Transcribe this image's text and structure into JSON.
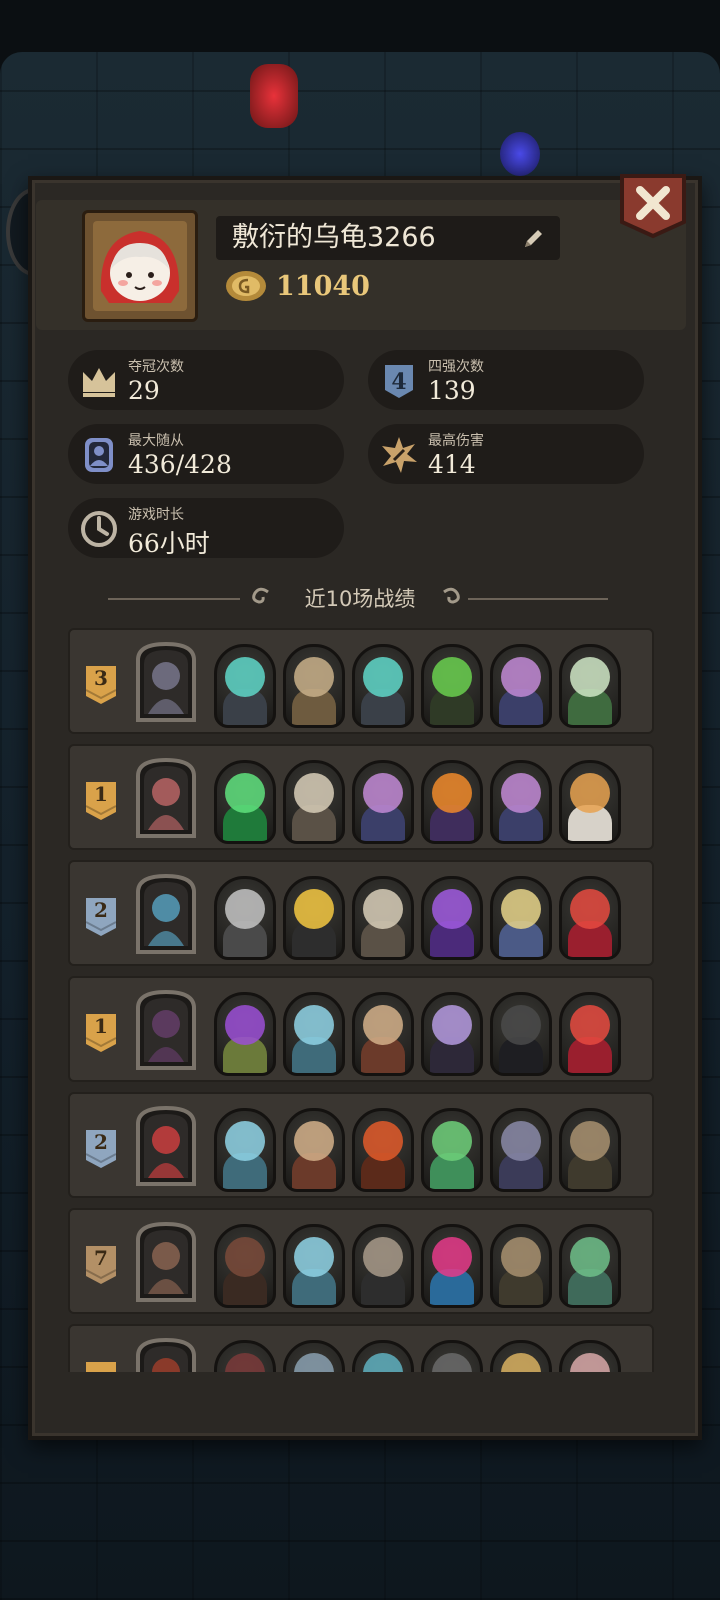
{
  "profile": {
    "name": "敷衍的乌龟3266",
    "coins": "11040",
    "avatar": "red-hood-girl-avatar"
  },
  "stats": [
    {
      "id": "crowns",
      "label": "夺冠次数",
      "value": "29",
      "icon": "crown-icon"
    },
    {
      "id": "top4",
      "label": "四强次数",
      "value": "139",
      "icon": "rank-4-shield-icon"
    },
    {
      "id": "max-followers",
      "label": "最大随从",
      "value": "436/428",
      "icon": "minion-card-icon"
    },
    {
      "id": "max-damage",
      "label": "最高伤害",
      "value": "414",
      "icon": "damage-burst-icon"
    },
    {
      "id": "playtime",
      "label": "游戏时长",
      "value": "66小时",
      "icon": "clock-icon"
    }
  ],
  "records_title": "近10场战绩",
  "colors": {
    "panel": "#2b2824",
    "rank_gold": "#d9a24a",
    "rank_silver": "#8fa6bf",
    "rank_bronze": "#b39066",
    "coin": "#e9c77a"
  },
  "records": [
    {
      "rank": "3",
      "tier": "gold",
      "hero": "wizard-hero",
      "hero_color": "#6c6a7c",
      "units": [
        [
          "#5fd7c9",
          "#3a4048"
        ],
        [
          "#c9b08a",
          "#6e5b3f"
        ],
        [
          "#5fd7c9",
          "#3a4048"
        ],
        [
          "#6ad04f",
          "#2f3a26"
        ],
        [
          "#c28ad6",
          "#3b3f69"
        ],
        [
          "#cfe6c6",
          "#3f6b3f"
        ]
      ]
    },
    {
      "rank": "1",
      "tier": "gold",
      "hero": "rat-hero",
      "hero_color": "#a35b5b",
      "units": [
        [
          "#5fe27e",
          "#1f7a3a"
        ],
        [
          "#d8ceb8",
          "#5a5146"
        ],
        [
          "#c28ad6",
          "#3b3f69"
        ],
        [
          "#f08a2a",
          "#3f2d5c"
        ],
        [
          "#c28ad6",
          "#3b3f69"
        ],
        [
          "#e8a250",
          "#d7d2c9"
        ]
      ]
    },
    {
      "rank": "2",
      "tier": "silver",
      "hero": "witch-hero",
      "hero_color": "#4f8ca5",
      "units": [
        [
          "#c4c4c4",
          "#4a4a4a"
        ],
        [
          "#f5c842",
          "#2d2d2d"
        ],
        [
          "#d8ceb8",
          "#5a5146"
        ],
        [
          "#a05ae0",
          "#4b2a7a"
        ],
        [
          "#e6d38a",
          "#4b5a86"
        ],
        [
          "#e64a3f",
          "#9a1f2e"
        ]
      ]
    },
    {
      "rank": "1",
      "tier": "gold",
      "hero": "cat-hero",
      "hero_color": "#5b3a5e",
      "units": [
        [
          "#9b4fd6",
          "#6b7a3a"
        ],
        [
          "#8fd3e6",
          "#3f6b7a"
        ],
        [
          "#d4b08a",
          "#6b3a2a"
        ],
        [
          "#b59ae0",
          "#2d2838"
        ],
        [
          "#4a4a4a",
          "#1e1e22"
        ],
        [
          "#e64a3f",
          "#9a1f2e"
        ]
      ]
    },
    {
      "rank": "2",
      "tier": "silver",
      "hero": "red-hood-hero",
      "hero_color": "#b23b3b",
      "units": [
        [
          "#8fd3e6",
          "#3f6b7a"
        ],
        [
          "#d4b08a",
          "#6b3a2a"
        ],
        [
          "#e25a2a",
          "#5b2a1a"
        ],
        [
          "#6fd07a",
          "#3f8f5a"
        ],
        [
          "#8a8aa8",
          "#3b3b58"
        ],
        [
          "#a89070",
          "#3f3a2d"
        ]
      ]
    },
    {
      "rank": "7",
      "tier": "bronze",
      "hero": "cat-king-hero",
      "hero_color": "#7a5a4a",
      "units": [
        [
          "#7a4a3a",
          "#3a2a22"
        ],
        [
          "#8fd3e6",
          "#3f6b7a"
        ],
        [
          "#a89a8a",
          "#2d2d2d"
        ],
        [
          "#e63a8a",
          "#2a6a9a"
        ],
        [
          "#a89070",
          "#3f3a2d"
        ],
        [
          "#6fc08a",
          "#3f6a5a"
        ]
      ]
    },
    {
      "rank": "",
      "tier": "gold",
      "hero": "fire-hero",
      "hero_color": "#8a3a2a",
      "units": [
        [
          "#7a3a3a",
          "#2d2222"
        ],
        [
          "#8aa0b0",
          "#3a3a3a"
        ],
        [
          "#5fb0c0",
          "#3a4048"
        ],
        [
          "#6a6a6a",
          "#2d2d2d"
        ],
        [
          "#d8b060",
          "#4a3a2a"
        ],
        [
          "#d8a8a8",
          "#4a3a3a"
        ]
      ]
    }
  ]
}
